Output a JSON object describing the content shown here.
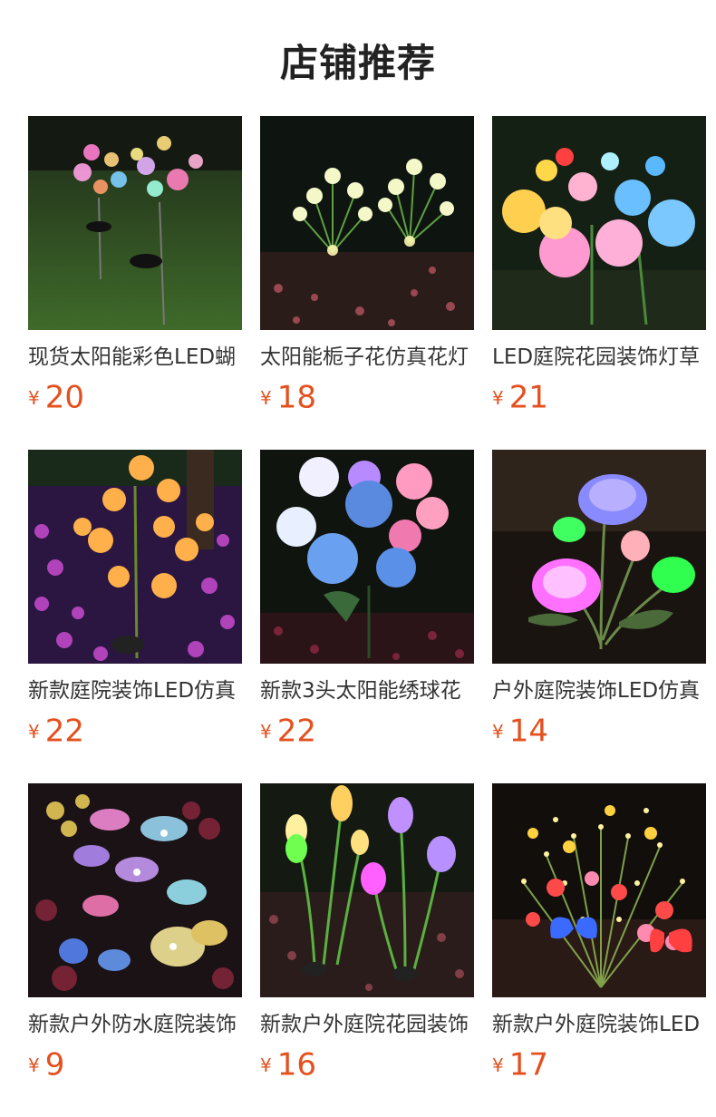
{
  "page": {
    "title": "店铺推荐",
    "currency_symbol": "¥"
  },
  "products": [
    {
      "name": "现货太阳能彩色LED蝴",
      "price": "20",
      "image": "solar-butterfly-lights-photo"
    },
    {
      "name": "太阳能栀子花仿真花灯",
      "price": "18",
      "image": "solar-gardenia-lights-photo"
    },
    {
      "name": "LED庭院花园装饰灯草",
      "price": "21",
      "image": "led-peony-lights-photo"
    },
    {
      "name": "新款庭院装饰LED仿真",
      "price": "22",
      "image": "led-lily-lights-photo"
    },
    {
      "name": "新款3头太阳能绣球花",
      "price": "22",
      "image": "solar-hydrangea-lights-photo"
    },
    {
      "name": "户外庭院装饰LED仿真",
      "price": "14",
      "image": "led-rose-lights-photo"
    },
    {
      "name": "新款户外防水庭院装饰",
      "price": "9",
      "image": "waterproof-dragonfly-lights-photo"
    },
    {
      "name": "新款户外庭院花园装饰",
      "price": "16",
      "image": "calla-lily-lights-photo"
    },
    {
      "name": "新款户外庭院装饰LED",
      "price": "17",
      "image": "flower-butterfly-lights-photo"
    }
  ],
  "colors": {
    "price": "#e4501e",
    "title": "#222222",
    "name": "#333333"
  }
}
